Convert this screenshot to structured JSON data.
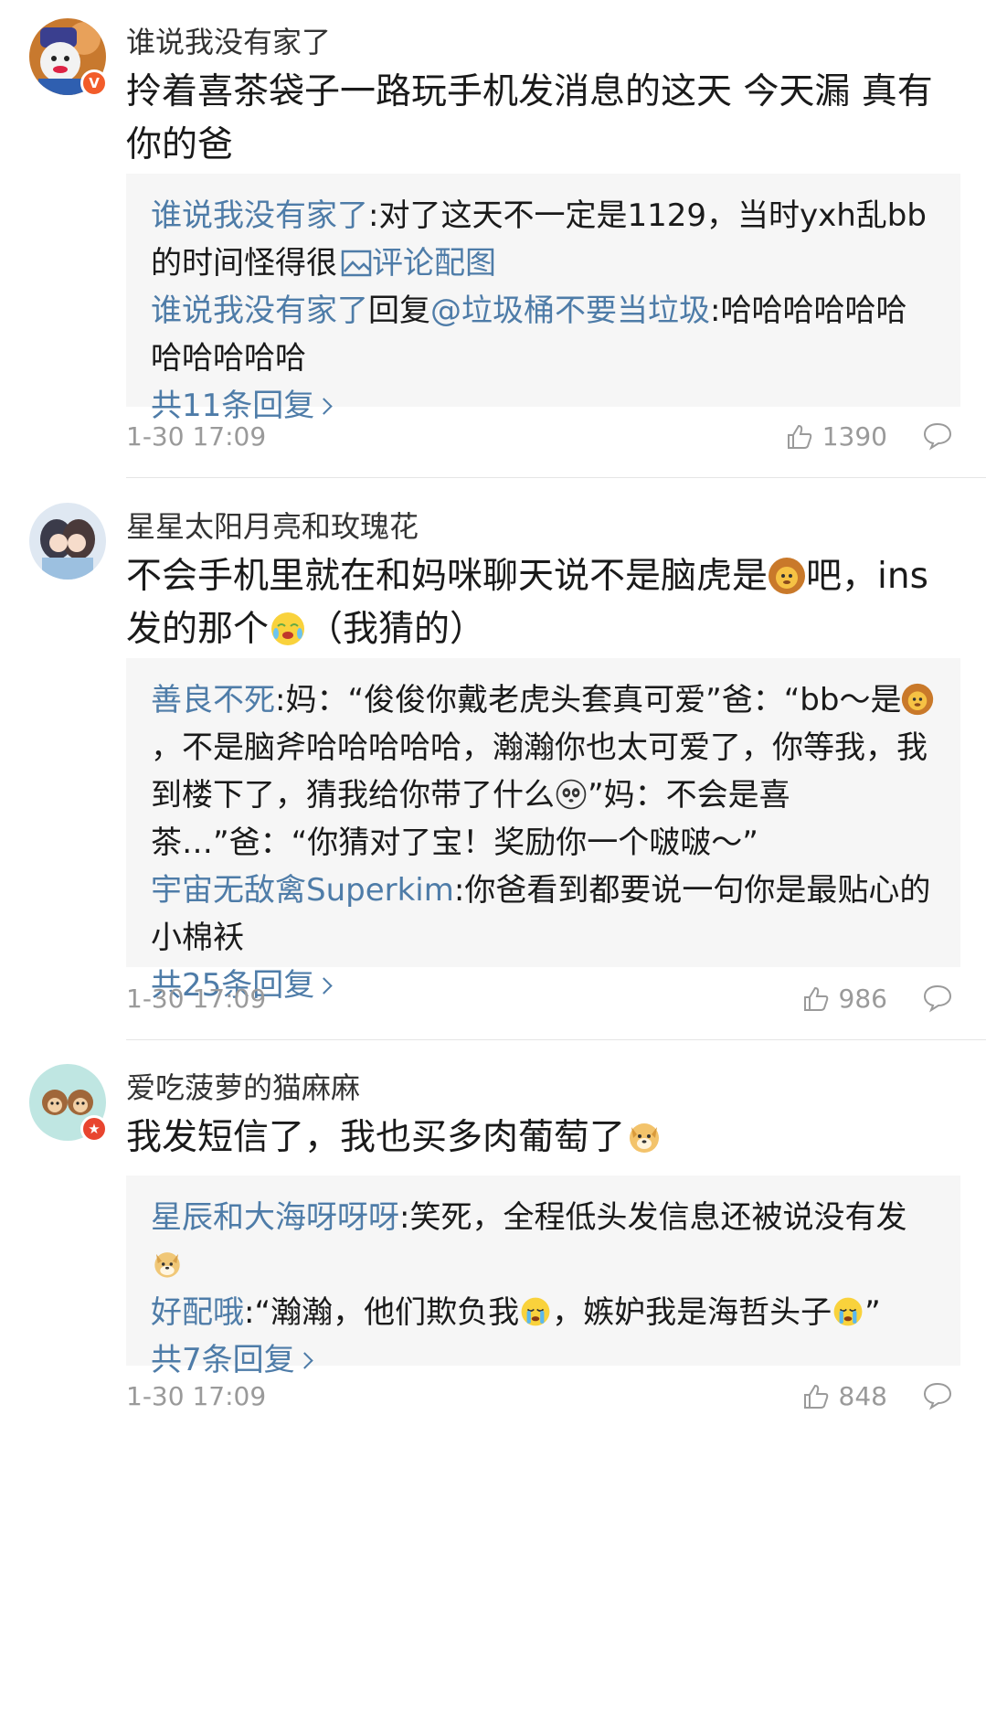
{
  "comments": [
    {
      "username": "谁说我没有家了",
      "content": "拎着喜茶袋子一路玩手机发消息的这天 今天漏 真有你的爸",
      "replies": [
        {
          "name": "谁说我没有家了",
          "sep": ":",
          "text": "对了这天不一定是1129，当时yxh乱bb的时间怪得很",
          "image_link": "评论配图"
        },
        {
          "name": "谁说我没有家了",
          "mid": "回复",
          "target": "@垃圾桶不要当垃圾",
          "sep": ":",
          "text": "哈哈哈哈哈哈哈哈哈哈哈"
        }
      ],
      "more": "共11条回复",
      "time": "1-30 17:09",
      "likes": "1390",
      "badge_color": "#f25c2a",
      "badge_text": "V"
    },
    {
      "username": "星星太阳月亮和玫瑰花",
      "content_a": "不会手机里就在和妈咪聊天说不是脑虎是",
      "content_b": "吧，ins发的那个",
      "content_c": "（我猜的）",
      "replies": [
        {
          "name": "善良不死",
          "sep": ":",
          "text_a": "妈：“俊俊你戴老虎头套真可爱”爸：“bb～是",
          "text_b": "，不是脑斧哈哈哈哈哈，瀚瀚你也太可爱了，你等我，我到楼下了，猜我给你带了什么",
          "text_c": "”妈：不会是喜茶…”爸：“你猜对了宝！奖励你一个啵啵～”"
        },
        {
          "name": "宇宙无敌禽Superkim",
          "sep": ":",
          "text": "你爸看到都要说一句你是最贴心的小棉袄"
        }
      ],
      "more": "共25条回复",
      "time": "1-30 17:09",
      "likes": "986"
    },
    {
      "username": "爱吃菠萝的猫麻麻",
      "content": "我发短信了，我也买多肉葡萄了",
      "replies": [
        {
          "name": "星辰和大海呀呀呀",
          "sep": ":",
          "text": "笑死，全程低头发信息还被说没有发"
        },
        {
          "name": "好配哦",
          "sep": ":",
          "text_a": "“瀚瀚，他们欺负我",
          "text_b": "，嫉妒我是海哲头子",
          "text_c": "”"
        }
      ],
      "more": "共7条回复",
      "time": "1-30 17:09",
      "likes": "848",
      "badge_color": "#e8452f",
      "badge_text": "★"
    }
  ],
  "colors": {
    "link": "#4e7ca8",
    "meta": "#9a9a9a",
    "reply_bg": "#f6f6f6"
  },
  "icons": [
    "thumbs-up-icon",
    "comment-bubble-icon",
    "image-icon",
    "chevron-right-icon"
  ]
}
